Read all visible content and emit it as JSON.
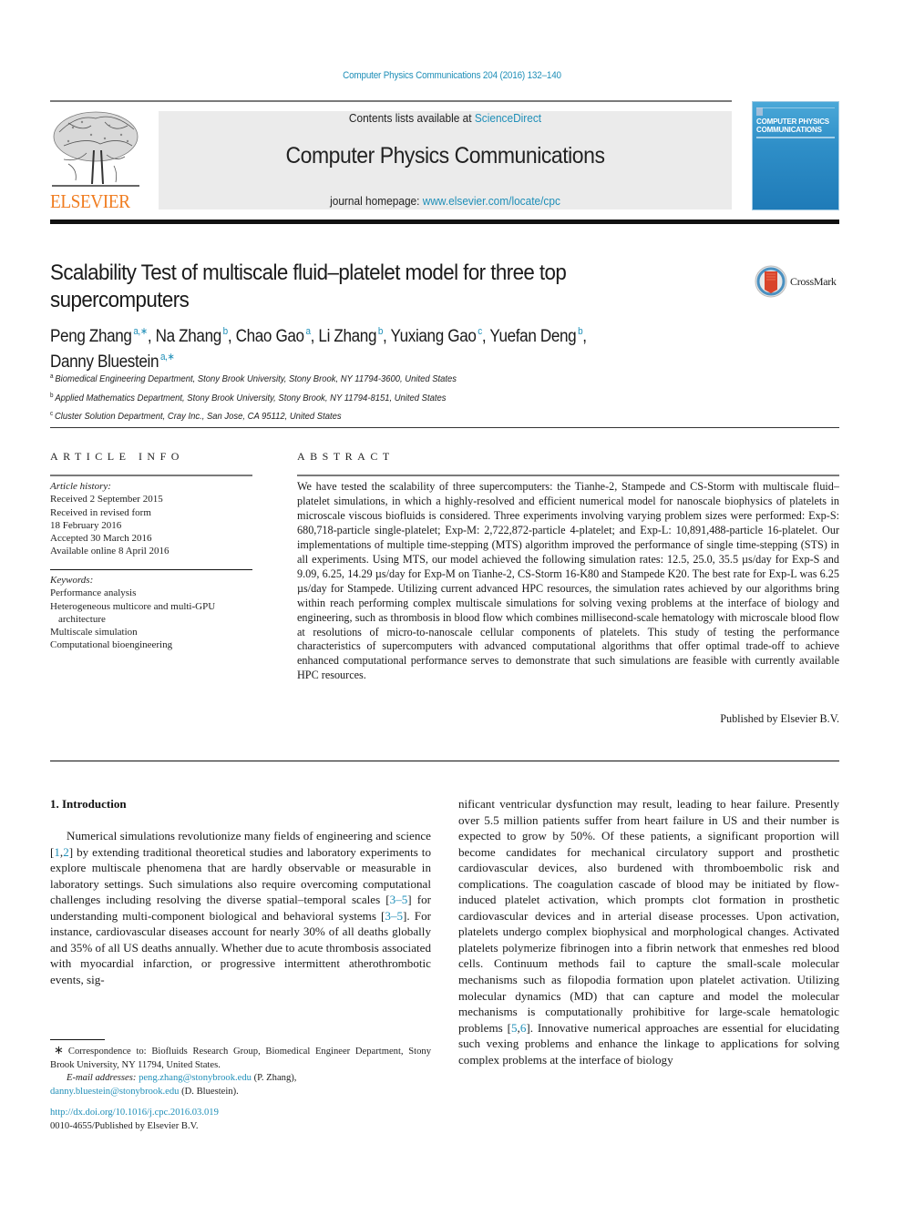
{
  "header": {
    "journal_ref": "Computer Physics Communications 204 (2016) 132–140",
    "publisher_wordmark": "ELSEVIER",
    "contents_prefix": "Contents lists available at ",
    "contents_link": "ScienceDirect",
    "journal_title": "Computer Physics Communications",
    "homepage_prefix": "journal homepage: ",
    "homepage_link": "www.elsevier.com/locate/cpc",
    "cover_title_line1": "COMPUTER PHYSICS",
    "cover_title_line2": "COMMUNICATIONS",
    "colors": {
      "link": "#1f8fb8",
      "elsevier_orange": "#f07c1f",
      "banner_bg": "#ebebeb"
    }
  },
  "article": {
    "title": "Scalability Test of multiscale fluid–platelet model for three top supercomputers",
    "crossmark_label": "CrossMark",
    "authors": [
      {
        "name": "Peng Zhang",
        "sup": "a,∗",
        "sep": ", "
      },
      {
        "name": "Na Zhang",
        "sup": "b",
        "sep": ", "
      },
      {
        "name": "Chao Gao",
        "sup": "a",
        "sep": ", "
      },
      {
        "name": "Li Zhang",
        "sup": "b",
        "sep": ", "
      },
      {
        "name": "Yuxiang Gao",
        "sup": "c",
        "sep": ", "
      },
      {
        "name": "Yuefan Deng",
        "sup": "b",
        "sep": ","
      },
      {
        "name": "Danny Bluestein",
        "sup": "a,∗",
        "sep": ""
      }
    ],
    "affiliations": [
      {
        "key": "a",
        "text": "Biomedical Engineering Department, Stony Brook University, Stony Brook, NY 11794-3600, United States"
      },
      {
        "key": "b",
        "text": "Applied Mathematics Department, Stony Brook University, Stony Brook, NY 11794-8151, United States"
      },
      {
        "key": "c",
        "text": "Cluster Solution Department, Cray Inc., San Jose, CA 95112, United States"
      }
    ]
  },
  "article_info": {
    "heading": "ARTICLE INFO",
    "history_label": "Article history:",
    "history": [
      "Received 2 September 2015",
      "Received in revised form",
      "18 February 2016",
      "Accepted 30 March 2016",
      "Available online 8 April 2016"
    ],
    "keywords_label": "Keywords:",
    "keywords": [
      "Performance analysis",
      "Heterogeneous multicore and multi-GPU",
      "architecture",
      "Multiscale simulation",
      "Computational bioengineering"
    ]
  },
  "abstract": {
    "heading": "ABSTRACT",
    "text": "We have tested the scalability of three supercomputers: the Tianhe-2, Stampede and CS-Storm with multiscale fluid–platelet simulations, in which a highly-resolved and efficient numerical model for nanoscale biophysics of platelets in microscale viscous biofluids is considered. Three experiments involving varying problem sizes were performed: Exp-S: 680,718-particle single-platelet; Exp-M: 2,722,872-particle 4-platelet; and Exp-L: 10,891,488-particle 16-platelet. Our implementations of multiple time-stepping (MTS) algorithm improved the performance of single time-stepping (STS) in all experiments. Using MTS, our model achieved the following simulation rates: 12.5, 25.0, 35.5 µs/day for Exp-S and 9.09, 6.25, 14.29 µs/day for Exp-M on Tianhe-2, CS-Storm 16-K80 and Stampede K20. The best rate for Exp-L was 6.25 µs/day for Stampede. Utilizing current advanced HPC resources, the simulation rates achieved by our algorithms bring within reach performing complex multiscale simulations for solving vexing problems at the interface of biology and engineering, such as thrombosis in blood flow which combines millisecond-scale hematology with microscale blood flow at resolutions of micro-to-nanoscale cellular components of platelets. This study of testing the performance characteristics of supercomputers with advanced computational algorithms that offer optimal trade-off to achieve enhanced computational performance serves to demonstrate that such simulations are feasible with currently available HPC resources.",
    "published_by": "Published by Elsevier B.V."
  },
  "introduction": {
    "heading": "1.  Introduction",
    "left_parts": [
      {
        "t": "Numerical simulations revolutionize many fields of engineering and science ["
      },
      {
        "t": "1",
        "link": true
      },
      {
        "t": ","
      },
      {
        "t": "2",
        "link": true
      },
      {
        "t": "] by extending traditional theoretical studies and laboratory experiments to explore multiscale phenomena that are hardly observable or measurable in laboratory settings. Such simulations also require overcoming computational challenges including resolving the diverse spatial–temporal scales ["
      },
      {
        "t": "3–5",
        "link": true
      },
      {
        "t": "] for understanding multi-component biological and behavioral systems ["
      },
      {
        "t": "3–5",
        "link": true
      },
      {
        "t": "]. For instance, cardiovascular diseases account for nearly 30% of all deaths globally and 35% of all US deaths annually. Whether due to acute thrombosis associated with myocardial infarction, or progressive intermittent atherothrombotic events, sig-"
      }
    ],
    "right_parts": [
      {
        "t": "nificant ventricular dysfunction may result, leading to hear failure. Presently over 5.5 million patients suffer from heart failure in US and their number is expected to grow by 50%. Of these patients, a significant proportion will become candidates for mechanical circulatory support and prosthetic cardiovascular devices, also burdened with thromboembolic risk and complications. The coagulation cascade of blood may be initiated by flow-induced platelet activation, which prompts clot formation in prosthetic cardiovascular devices and in arterial disease processes. Upon activation, platelets undergo complex biophysical and morphological changes. Activated platelets polymerize fibrinogen into a fibrin network that enmeshes red blood cells. Continuum methods fail to capture the small-scale molecular mechanisms such as filopodia formation upon platelet activation. Utilizing molecular dynamics (MD) that can capture and model the molecular mechanisms is computationally prohibitive for large-scale hematologic problems ["
      },
      {
        "t": "5",
        "link": true
      },
      {
        "t": ","
      },
      {
        "t": "6",
        "link": true
      },
      {
        "t": "]. Innovative numerical approaches are essential for elucidating such vexing problems and enhance the linkage to applications for solving complex problems at the interface of biology"
      }
    ]
  },
  "footnote": {
    "star": "∗",
    "correspondence": "Correspondence to: Biofluids Research Group, Biomedical Engineer Department, Stony Brook University, NY 11794, United States.",
    "email_label": "E-mail addresses: ",
    "email1": "peng.zhang@stonybrook.edu",
    "email1_owner": " (P. Zhang),",
    "email2": "danny.bluestein@stonybrook.edu",
    "email2_owner": " (D. Bluestein).",
    "doi": "http://dx.doi.org/10.1016/j.cpc.2016.03.019",
    "issn": "0010-4655/Published by Elsevier B.V."
  }
}
